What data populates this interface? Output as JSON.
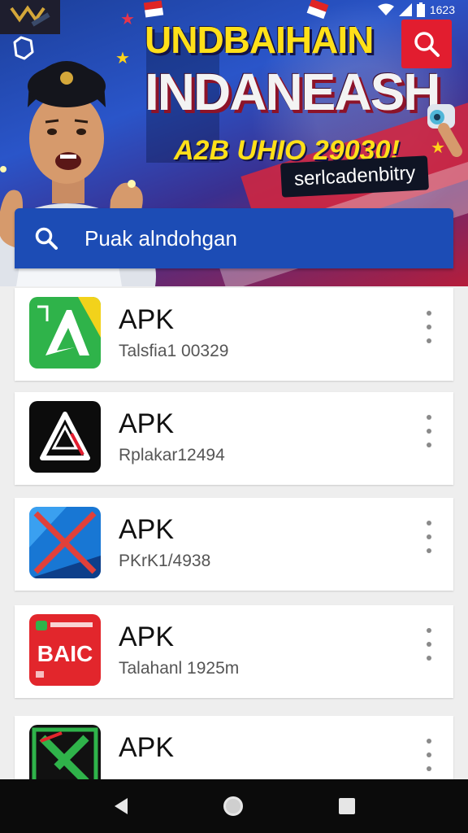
{
  "status_bar": {
    "time": "1623",
    "icons": [
      "wifi-icon",
      "signal-icon",
      "battery-icon"
    ]
  },
  "banner": {
    "line1": "UNDBAIHAIN",
    "line2": "INDANEASH",
    "line3": "A2B UHIO 29030!",
    "tagline": "serlcadenbitry",
    "colors": {
      "headline": "#ffe019",
      "background": "#2a55c9",
      "accent": "#e21d2f"
    }
  },
  "search": {
    "placeholder": "Puak alndohgan",
    "icon": "search-icon"
  },
  "apps": [
    {
      "name": "APK",
      "subtitle": "Talsfia1 00329",
      "icon": "green-a-app-icon"
    },
    {
      "name": "APK",
      "subtitle": "Rplakar12494",
      "icon": "black-a-app-icon"
    },
    {
      "name": "APK",
      "subtitle": "PKrK1/4938",
      "icon": "blue-x-app-icon"
    },
    {
      "name": "APK",
      "subtitle": "Talahanl 1925m",
      "icon": "red-bac-app-icon"
    },
    {
      "name": "APK",
      "subtitle": "",
      "icon": "green-k-app-icon"
    }
  ],
  "nav_bar": {
    "buttons": [
      "back-icon",
      "home-icon",
      "recents-icon"
    ]
  }
}
